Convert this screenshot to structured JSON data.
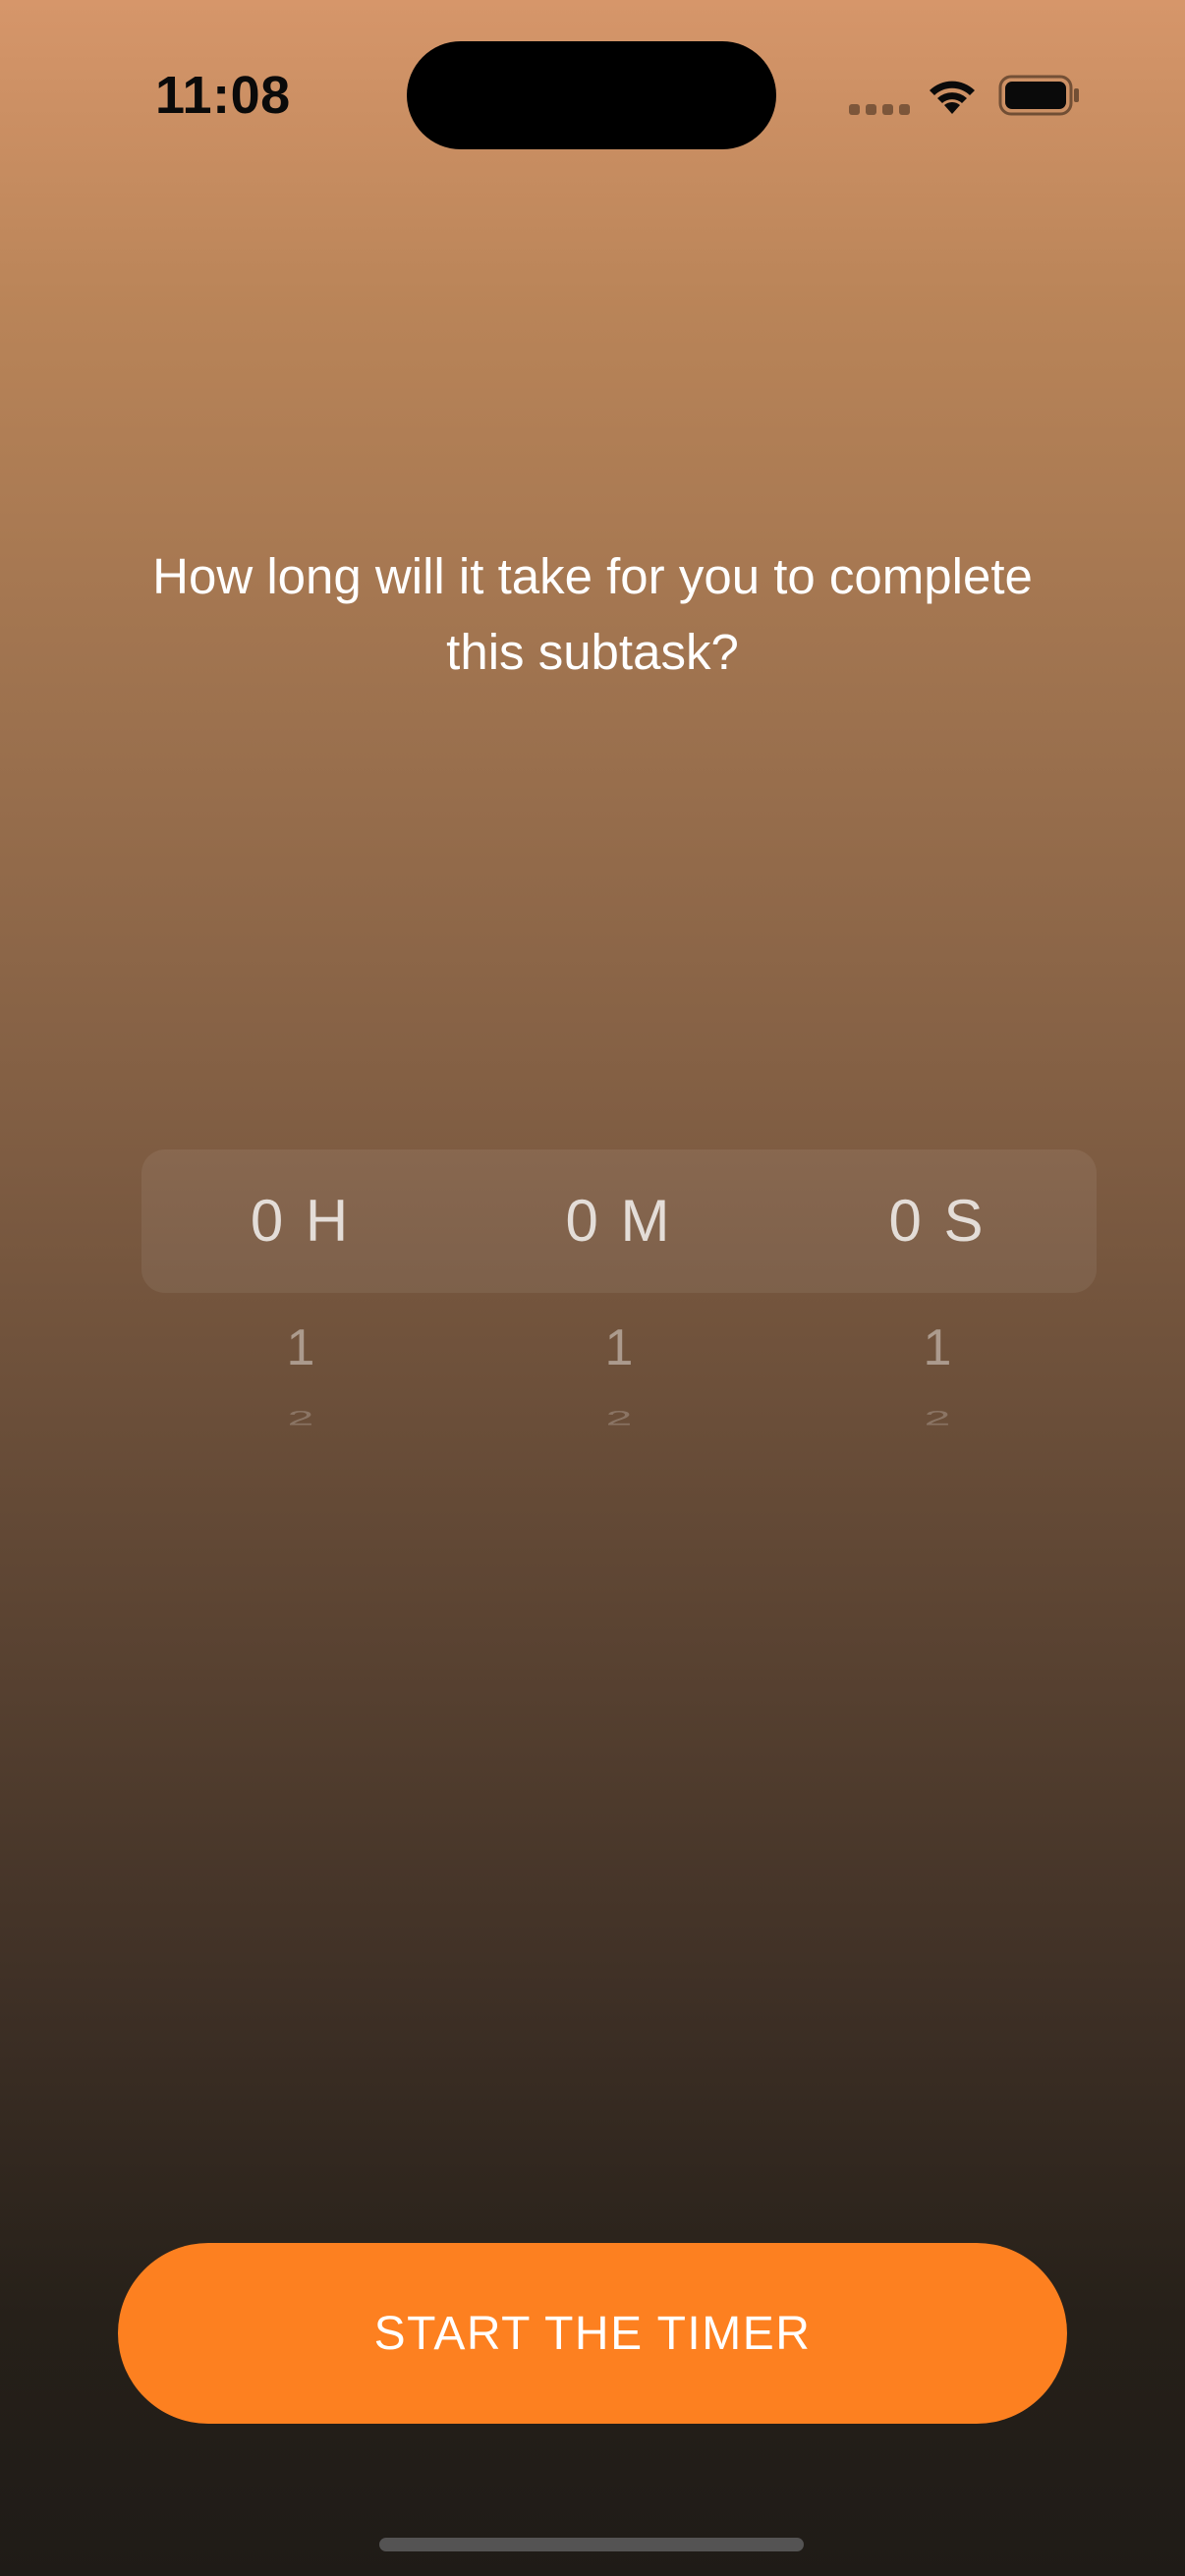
{
  "status_bar": {
    "time": "11:08",
    "icons": [
      "signal-icon",
      "wifi-icon",
      "battery-icon"
    ]
  },
  "question": {
    "text": "How long will it take for you to complete this subtask?"
  },
  "duration_picker": {
    "columns": [
      {
        "unit": "hours",
        "selected": "0 H",
        "next": "1",
        "next2": "2"
      },
      {
        "unit": "minutes",
        "selected": "0 M",
        "next": "1",
        "next2": "2"
      },
      {
        "unit": "seconds",
        "selected": "0 S",
        "next": "1",
        "next2": "2"
      }
    ]
  },
  "start_button": {
    "label": "START THE TIMER"
  },
  "colors": {
    "accent": "#fd8020",
    "gradient_top": "#d6966a",
    "gradient_bottom": "#1f1b17"
  }
}
